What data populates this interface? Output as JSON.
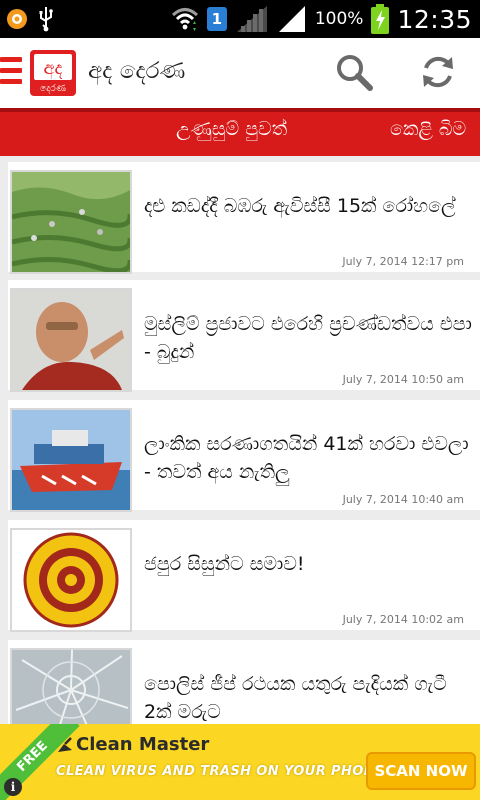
{
  "status_bar": {
    "sim_badge": "1",
    "battery_percent": "100%",
    "time": "12:35"
  },
  "app_bar": {
    "logo_text": "අද",
    "logo_subtext": "දෙරණ",
    "title": "අද දෙරණ",
    "icons": [
      "menu-icon",
      "search-icon",
      "refresh-icon"
    ]
  },
  "tabs": {
    "active": "උණුසුම් පුවත්",
    "next": "කෙළි බිම"
  },
  "articles": [
    {
      "title": "දළු කඩද්දී බඹරු ඇවිස්සී 15ක් රෝහලේ",
      "timestamp": "July 7, 2014 12:17 pm",
      "thumb": "tea-plantation"
    },
    {
      "title": "මුස්ලිම් ප්‍රජාවට එරෙහි ප්‍රචණ්ඩත්වය එපා - බුදුන්",
      "timestamp": "July 7, 2014 10:50 am",
      "thumb": "monk-portrait"
    },
    {
      "title": "ලාංකික සරණාගතයින් 41ක් හරවා එවලා - තවත් අය නැතිලු",
      "timestamp": "July 7, 2014 10:40 am",
      "thumb": "boat"
    },
    {
      "title": "ජපුර සිසුන්ට සමාව!",
      "timestamp": "July 7, 2014 10:02 am",
      "thumb": "university-seal"
    },
    {
      "title": "පොලිස් ජීප් රථයක යතුරු පැදියක් ගැටී 2ක් මරුට",
      "timestamp": "",
      "thumb": "broken-glass"
    }
  ],
  "ad": {
    "badge": "FREE",
    "title": "Clean Master",
    "tagline": "CLEAN VIRUS AND TRASH ON YOUR PHONE!",
    "cta": "SCAN NOW",
    "info": "i"
  },
  "colors": {
    "brand_red": "#d71b1b",
    "ad_yellow": "#fbd623"
  }
}
